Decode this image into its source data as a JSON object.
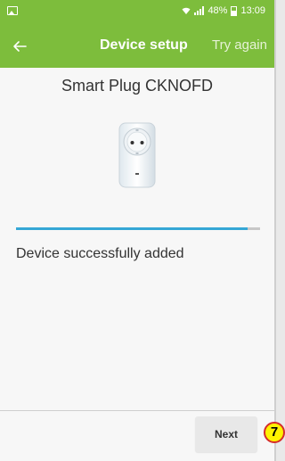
{
  "status_bar": {
    "battery_percent": "48%",
    "time": "13:09"
  },
  "app_bar": {
    "title": "Device setup",
    "action_label": "Try again",
    "back_icon": "arrow-left-icon"
  },
  "device": {
    "name": "Smart Plug CKNOFD",
    "image_icon": "smart-plug-icon"
  },
  "progress": {
    "fraction": 0.95
  },
  "status_message": "Device successfully added",
  "footer": {
    "next_label": "Next"
  },
  "annotation": {
    "step_number": "7"
  },
  "colors": {
    "app_bar_green": "#7dbd3c",
    "progress_blue": "#35a7d6",
    "badge_yellow": "#fff200",
    "badge_red": "#d52b2b"
  }
}
